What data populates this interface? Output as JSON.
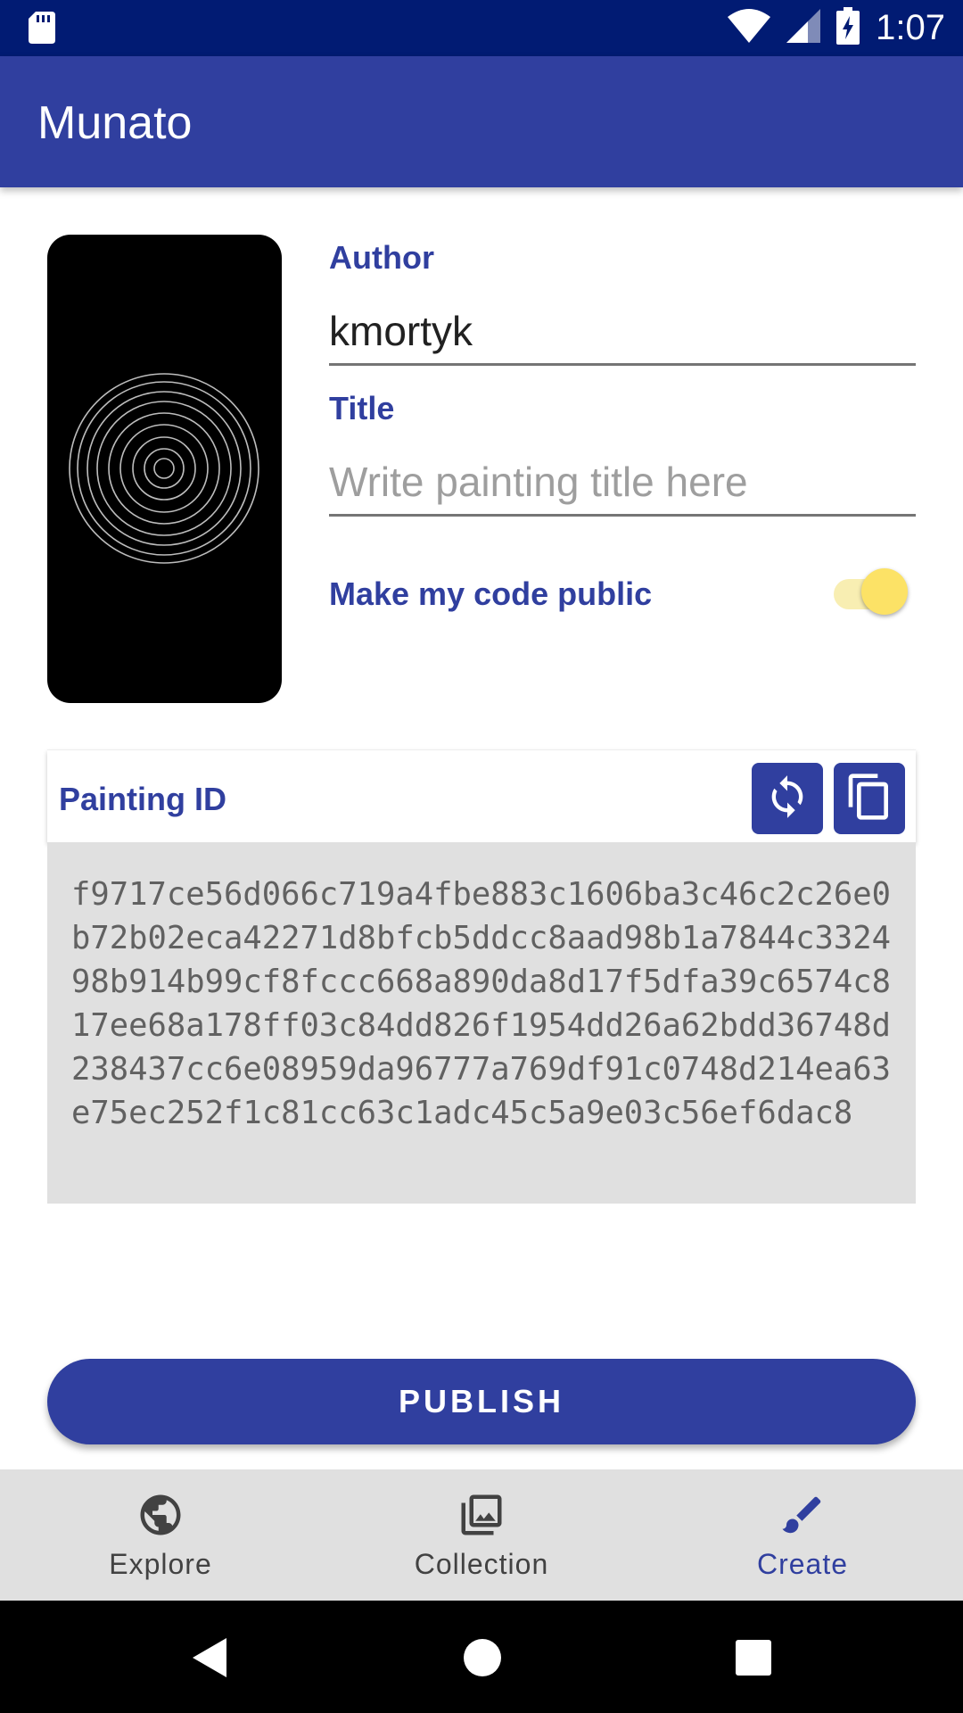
{
  "status_bar": {
    "time": "1:07",
    "icons": [
      "sd-card-icon",
      "wifi-icon",
      "cell-signal-icon",
      "battery-charging-icon"
    ]
  },
  "app_bar": {
    "title": "Munato"
  },
  "form": {
    "author_label": "Author",
    "author_value": "kmortyk",
    "title_label": "Title",
    "title_placeholder": "Write painting title here",
    "public_label": "Make my code public",
    "public_enabled": true
  },
  "painting": {
    "id_label": "Painting ID",
    "id_value": "f9717ce56d066c719a4fbe883c1606ba3c46c2c26e0b72b02eca42271d8bfcb5ddcc8aad98b1a7844c332498b914b99cf8fccc668a890da8d17f5dfa39c6574c817ee68a178ff03c84dd826f1954dd26a62bdd36748d238437cc6e08959da96777a769df91c0748d214ea63e75ec252f1c81cc63c1adc45c5a9e03c56ef6dac8",
    "actions": [
      "refresh-icon",
      "copy-icon"
    ]
  },
  "publish_label": "PUBLISH",
  "bottom_nav": {
    "items": [
      {
        "label": "Explore",
        "icon": "globe-icon",
        "active": false
      },
      {
        "label": "Collection",
        "icon": "gallery-icon",
        "active": false
      },
      {
        "label": "Create",
        "icon": "brush-icon",
        "active": true
      }
    ]
  },
  "colors": {
    "primary": "#303f9f",
    "status_bar": "#011b73",
    "accent": "#fce266",
    "id_box": "#e0e0e0"
  }
}
